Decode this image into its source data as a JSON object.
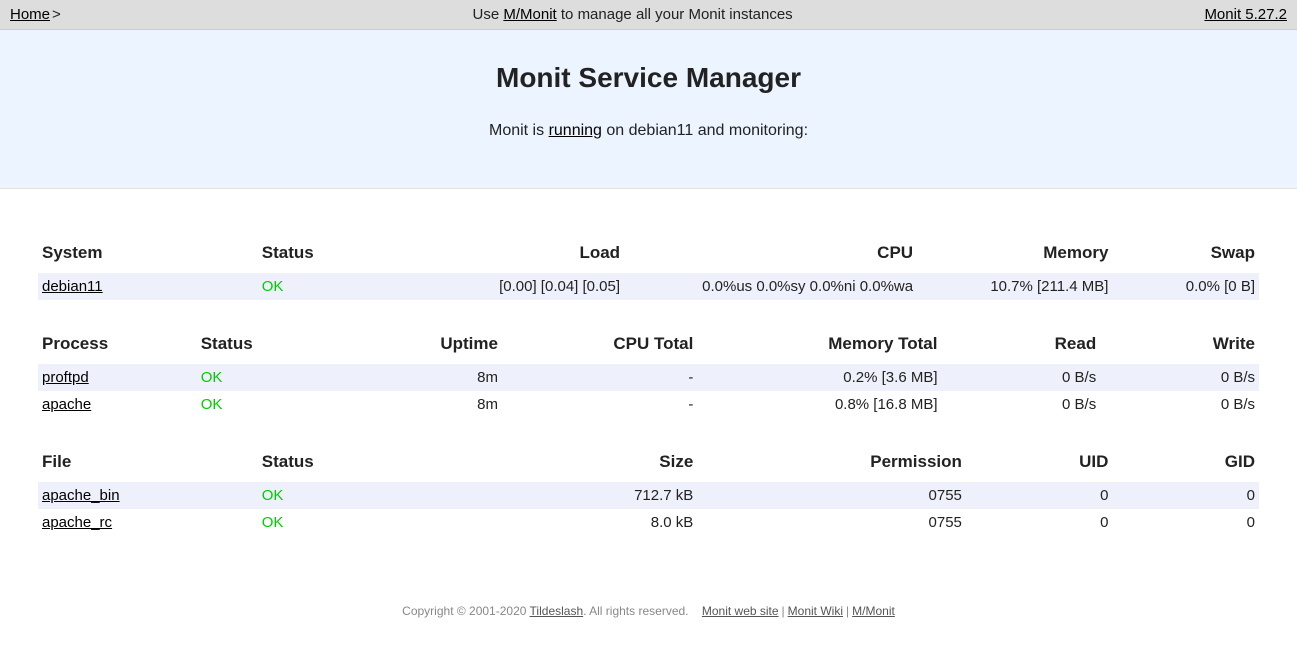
{
  "topbar": {
    "home": "Home",
    "arrow": ">",
    "center_pre": "Use ",
    "center_link": "M/Monit",
    "center_post": " to manage all your Monit instances",
    "version": "Monit 5.27.2"
  },
  "header": {
    "title": "Monit Service Manager",
    "sub_pre": "Monit is ",
    "sub_link": "running",
    "sub_post": " on debian11 and monitoring:"
  },
  "system": {
    "headers": {
      "name": "System",
      "status": "Status",
      "load": "Load",
      "cpu": "CPU",
      "memory": "Memory",
      "swap": "Swap"
    },
    "rows": [
      {
        "name": "debian11",
        "status": "OK",
        "load": "[0.00] [0.04] [0.05]",
        "cpu": "0.0%us 0.0%sy 0.0%ni 0.0%wa",
        "memory": "10.7% [211.4 MB]",
        "swap": "0.0% [0 B]"
      }
    ]
  },
  "process": {
    "headers": {
      "name": "Process",
      "status": "Status",
      "uptime": "Uptime",
      "cpu": "CPU Total",
      "memory": "Memory Total",
      "read": "Read",
      "write": "Write"
    },
    "rows": [
      {
        "name": "proftpd",
        "status": "OK",
        "uptime": "8m",
        "cpu": "-",
        "memory": "0.2% [3.6 MB]",
        "read": "0 B/s",
        "write": "0 B/s"
      },
      {
        "name": "apache",
        "status": "OK",
        "uptime": "8m",
        "cpu": "-",
        "memory": "0.8% [16.8 MB]",
        "read": "0 B/s",
        "write": "0 B/s"
      }
    ]
  },
  "file": {
    "headers": {
      "name": "File",
      "status": "Status",
      "size": "Size",
      "permission": "Permission",
      "uid": "UID",
      "gid": "GID"
    },
    "rows": [
      {
        "name": "apache_bin",
        "status": "OK",
        "size": "712.7 kB",
        "permission": "0755",
        "uid": "0",
        "gid": "0"
      },
      {
        "name": "apache_rc",
        "status": "OK",
        "size": "8.0 kB",
        "permission": "0755",
        "uid": "0",
        "gid": "0"
      }
    ]
  },
  "footer": {
    "copyright_pre": "Copyright © 2001-2020 ",
    "tildeslash": "Tildeslash",
    "copyright_post": ". All rights reserved.",
    "link1": "Monit web site",
    "link2": "Monit Wiki",
    "link3": "M/Monit"
  }
}
